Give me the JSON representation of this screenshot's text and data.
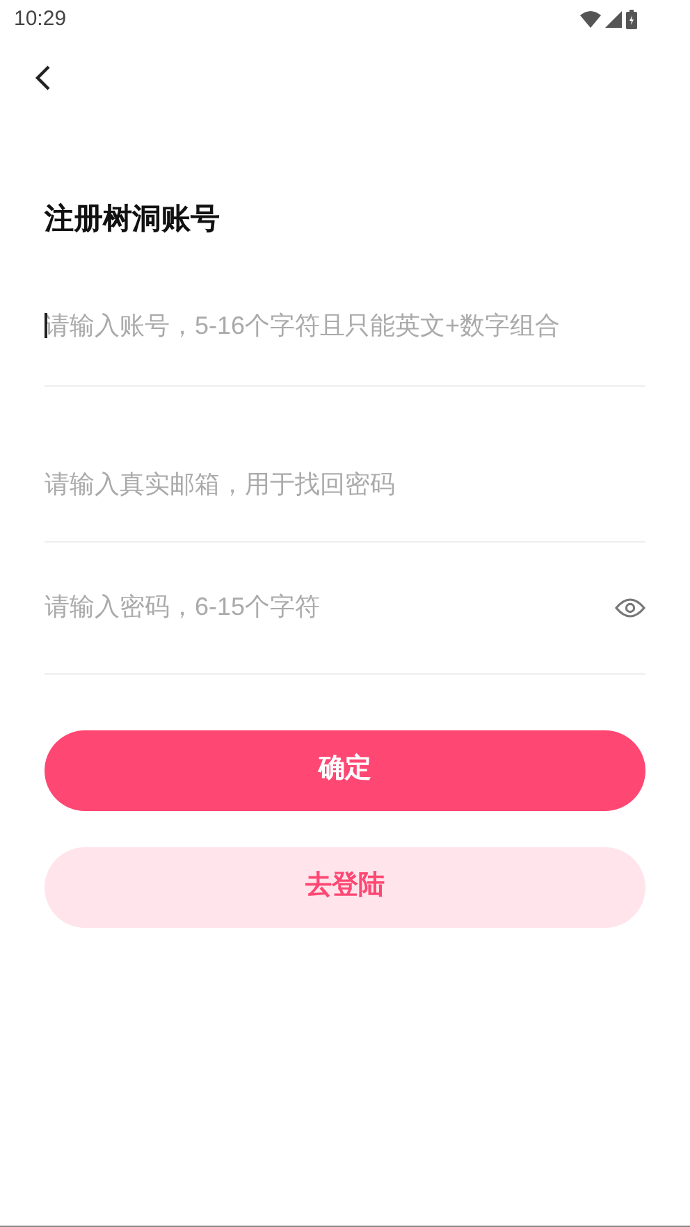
{
  "status_bar": {
    "time": "10:29"
  },
  "title": "注册树洞账号",
  "fields": [
    {
      "kind": "text",
      "placeholder": "请输入账号，5-16个字符且只能英文+数字组合",
      "focused": true
    },
    {
      "kind": "text",
      "placeholder": "请输入真实邮箱，用于找回密码",
      "focused": false
    },
    {
      "kind": "password",
      "placeholder": "请输入密码，6-15个字符",
      "focused": false
    }
  ],
  "buttons": [
    {
      "kind": "primary",
      "label": "确定"
    },
    {
      "kind": "secondary",
      "label": "去登陆"
    }
  ]
}
